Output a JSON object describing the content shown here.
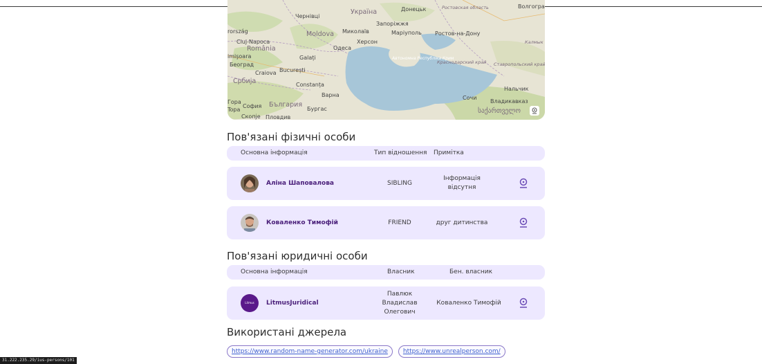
{
  "map": {
    "labels": {
      "ukraina": "Україна",
      "donetsk": "Донецьк",
      "rostov_obl": "Ростовская область",
      "volgograd": "Волгоград",
      "chernivtsi": "Чернівці",
      "zaporizhzhia": "Запоріжжя",
      "rorszag": "rország",
      "moldova": "Moldova",
      "mykolaiv": "Миколаїв",
      "mariupol": "Маріуполь",
      "rostov_na_donu": "Ростов-на-Дону",
      "kalmykia": "Калмык",
      "cluj": "Cluj-Napoca",
      "kherson": "Херсон",
      "romania": "România",
      "odesa": "Одеса",
      "timisoara": "imişoara",
      "galati": "Galați",
      "krym": "Автономна Республіка Крим",
      "krasnodar": "Краснодарский край",
      "stavropol": "Ставропольский край",
      "beograd": "Београд",
      "craiova": "Craiova",
      "bucuresti": "București",
      "srbija": "Србија",
      "constanta": "Constanța",
      "varna": "Варна",
      "nalchik": "Нальчик",
      "sochi": "Сочи",
      "gora": "Гора",
      "sofia": "София",
      "bulgaria": "България",
      "vladikavkaz": "Владикавказ",
      "topa": "Topa",
      "burgas": "Бургас",
      "skopje": "Скопје",
      "plovdiv": "Пловдив",
      "sakartvelo": "საქართველო"
    }
  },
  "persons": {
    "title": "Пов'язані фізичні особи",
    "headers": {
      "main": "Основна інформація",
      "relation": "Тип відношення",
      "note": "Примітка"
    },
    "rows": [
      {
        "name": "Аліна Шаповалова",
        "relation": "SIBLING",
        "note": "Інформація відсутня"
      },
      {
        "name": "Коваленко Тимофій",
        "relation": "FRIEND",
        "note": "друг дитинства"
      }
    ]
  },
  "companies": {
    "title": "Пов'язані юридичні особи",
    "headers": {
      "main": "Основна інформація",
      "owner": "Власник",
      "beneficiary": "Бен. власник"
    },
    "rows": [
      {
        "name": "LitmusJuridical",
        "logo_text": "Litmus",
        "owner": "Павлюк Владислав Олегович",
        "beneficiary": "Коваленко Тимофій"
      }
    ]
  },
  "sources": {
    "title": "Використані джерела",
    "links": [
      "https://www.random-name-generator.com/ukraine",
      "https://www.unrealperson.com/"
    ]
  },
  "status": {
    "url": "31.222.235.29/ius-persons/101"
  },
  "colors": {
    "accent": "#4a1f7a",
    "row_bg": "#ede8ff",
    "icon": "#6a4bb5"
  }
}
